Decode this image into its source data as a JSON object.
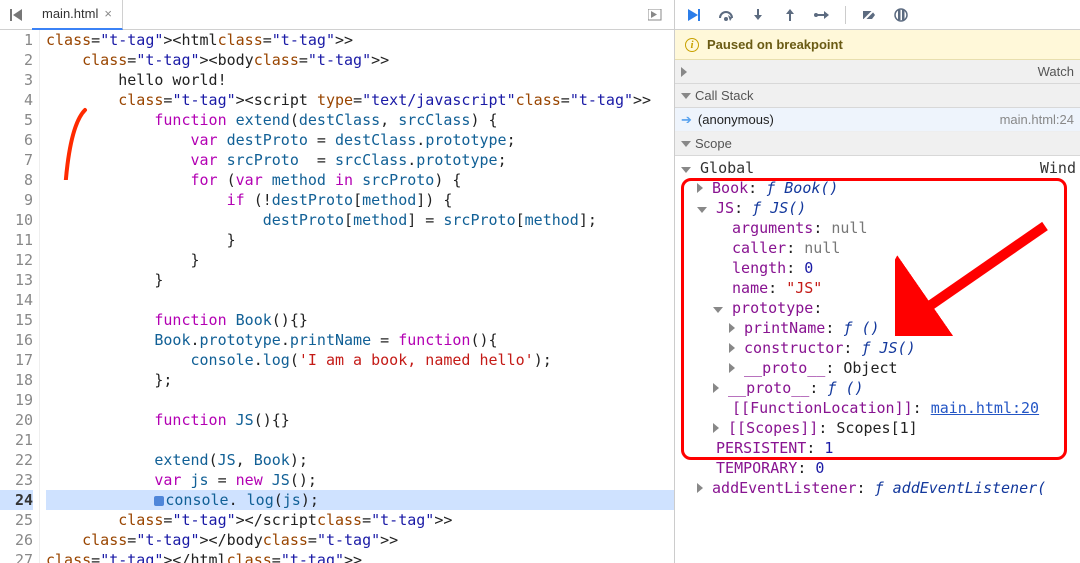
{
  "tab": {
    "name": "main.html",
    "close": "×"
  },
  "code": {
    "lines": [
      "<html>",
      "    <body>",
      "        hello world!",
      "        <script type=\"text/javascript\">",
      "            function extend(destClass, srcClass) {",
      "                var destProto = destClass.prototype;",
      "                var srcProto  = srcClass.prototype;",
      "                for (var method in srcProto) {",
      "                    if (!destProto[method]) {",
      "                        destProto[method] = srcProto[method];",
      "                    }",
      "                }",
      "            }",
      "",
      "            function Book(){}",
      "            Book.prototype.printName = function(){",
      "                console.log('I am a book, named hello');",
      "            };",
      "",
      "            function JS(){}",
      "",
      "            extend(JS, Book);",
      "            var js = new JS();",
      "            console. log(js);",
      "        </script>",
      "    </body>",
      "</html>"
    ],
    "highlight_line": 24
  },
  "banner": {
    "text": "Paused on breakpoint"
  },
  "panes": {
    "watch": "Watch",
    "callstack": "Call Stack",
    "scope": "Scope"
  },
  "stack": {
    "frame": "(anonymous)",
    "location": "main.html:24"
  },
  "scope": {
    "global_label": "Global",
    "global_type": "Wind",
    "rows": [
      {
        "ind": 1,
        "tri": "right",
        "key": "Book",
        "sep": ": ",
        "valA": "ƒ ",
        "valB": "Book()",
        "style": "fn"
      },
      {
        "ind": 1,
        "tri": "down",
        "key": "JS",
        "sep": ": ",
        "valA": "ƒ ",
        "valB": "JS()",
        "style": "fn"
      },
      {
        "ind": 2,
        "tri": "",
        "key": "arguments",
        "sep": ": ",
        "valA": "",
        "valB": "null",
        "style": "val"
      },
      {
        "ind": 2,
        "tri": "",
        "key": "caller",
        "sep": ": ",
        "valA": "",
        "valB": "null",
        "style": "val"
      },
      {
        "ind": 2,
        "tri": "",
        "key": "length",
        "sep": ": ",
        "valA": "",
        "valB": "0",
        "style": "num"
      },
      {
        "ind": 2,
        "tri": "",
        "key": "name",
        "sep": ": ",
        "valA": "",
        "valB": "\"JS\"",
        "style": "str"
      },
      {
        "ind": 2,
        "tri": "down",
        "key": "prototype",
        "sep": ":",
        "valA": "",
        "valB": "",
        "style": "obj"
      },
      {
        "ind": 3,
        "tri": "right",
        "key": "printName",
        "sep": ": ",
        "valA": "ƒ ",
        "valB": "()",
        "style": "fn"
      },
      {
        "ind": 3,
        "tri": "right",
        "key": "constructor",
        "sep": ": ",
        "valA": "ƒ ",
        "valB": "JS()",
        "style": "fn"
      },
      {
        "ind": 3,
        "tri": "right",
        "key": "__proto__",
        "sep": ": ",
        "valA": "",
        "valB": "Object",
        "style": "obj"
      },
      {
        "ind": 2,
        "tri": "right",
        "key": "__proto__",
        "sep": ": ",
        "valA": "ƒ ",
        "valB": "()",
        "style": "fn"
      },
      {
        "ind": 2,
        "tri": "",
        "key": "[[FunctionLocation]]",
        "sep": ": ",
        "valA": "",
        "valB": "main.html:20",
        "style": "link"
      },
      {
        "ind": 2,
        "tri": "right",
        "key": "[[Scopes]]",
        "sep": ": ",
        "valA": "",
        "valB": "Scopes[1]",
        "style": "obj"
      },
      {
        "ind": 1,
        "tri": "",
        "key": "PERSISTENT",
        "sep": ": ",
        "valA": "",
        "valB": "1",
        "style": "num"
      },
      {
        "ind": 1,
        "tri": "",
        "key": "TEMPORARY",
        "sep": ": ",
        "valA": "",
        "valB": "0",
        "style": "num"
      },
      {
        "ind": 1,
        "tri": "right",
        "key": "addEventListener",
        "sep": ": ",
        "valA": "ƒ ",
        "valB": "addEventListener(",
        "style": "fn"
      }
    ]
  }
}
